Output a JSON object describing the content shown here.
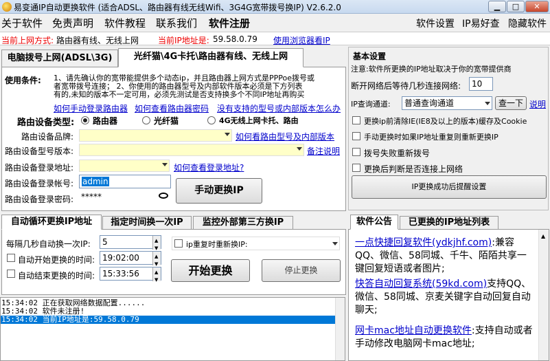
{
  "window": {
    "title": "易变通IP自动更换软件 (适合ADSL、路由器有线无线Wifi、3G4G宽带拨号换IP) V2.6.2.0",
    "btn_min": "▁",
    "btn_max": "□",
    "btn_close": "✕"
  },
  "menu": {
    "items": [
      "关于软件",
      "免责声明",
      "软件教程",
      "联系我们",
      "软件注册"
    ],
    "right": [
      "软件设置",
      "IP易好查",
      "隐藏软件"
    ]
  },
  "status": {
    "mode_label": "当前上网方式:",
    "mode_value": "路由器有线、无线上网",
    "ip_label": "当前IP地址是:",
    "ip_value": "59.58.0.79",
    "browser_link": "使用浏览器看IP"
  },
  "tabs": {
    "adsl": "电脑拨号上网(ADSL\\3G)",
    "router": "光纤猫\\4G卡托\\路由器有线、无线上网"
  },
  "router_panel": {
    "condition_label": "使用条件:",
    "condition_lines": [
      "1、请先确认你的宽带能提供多个动态ip，并且路由器上网方式是PPPoe拨号或",
      "者宽带拨号连接；  2、你使用的路由器型号及内部软件版本必须是下方列表",
      "有的,未知的版本不一定可用，必须先测试是否支持换多个不同IP地址再购买"
    ],
    "links": [
      "如何手动登录路由器",
      "如何查看路由器密码",
      "没有支持的型号或内部版本怎么办"
    ],
    "device_type_label": "路由设备类型:",
    "device_types": [
      "路由器",
      "光纤猫",
      "4G无线上网卡托、路由"
    ],
    "brand_label": "路由设备品牌:",
    "brand_link": "如何看路由型号及内部版本",
    "model_label": "路由设备型号版本:",
    "model_link": "备注说明",
    "address_label": "路由设备登录地址:",
    "address_link": "如何查看登录地址?",
    "account_label": "路由设备登录帐号:",
    "account_value": "admin",
    "password_label": "路由设备登录密码:",
    "password_value": "*****",
    "manual_button": "手动更换IP"
  },
  "basic_settings": {
    "title": "基本设置",
    "note": "注意:软件所更换的IP地址取决于你的宽带提供商",
    "reconnect_label": "断开网络后等待几秒连接网络:",
    "reconnect_value": "10",
    "query_label": "IP查询通道:",
    "query_value": "普通查询通道",
    "check_button": "查一下",
    "explain_link": "说明",
    "checkboxes": [
      "更换ip前清除IE(IE8及以上的版本)缓存及Cookie",
      "手动更换时如果IP地址重复则重新更换IP",
      "拨号失败重新拨号",
      "更换后判断是否连接上网络"
    ],
    "remind_button": "IP更换成功后提醒设置"
  },
  "auto_tabs": {
    "labels": [
      "自动循环更换IP地址",
      "指定时间换一次IP",
      "监控外部第三方换IP"
    ],
    "interval_label": "每隔几秒自动换一次IP:",
    "interval_value": "5",
    "start_label": "自动开始更换的时间:",
    "start_value": "19:02:00",
    "end_label": "自动结束更换的时间:",
    "end_value": "15:33:56",
    "repeat_label": "ip重复时重新换IP:",
    "start_button": "开始更换",
    "stop_button": "停止更换"
  },
  "log": [
    "15:34:02 正在获取网络数据配置......",
    "15:34:02 软件未注册!",
    "15:34:02 当前IP地址是:59.58.0.79"
  ],
  "right_tabs": {
    "notice": "软件公告",
    "history": "已更换的IP地址列表"
  },
  "announcement": [
    {
      "link": "一点快捷回复软件(ydkjhf.com)",
      "text": ":兼容QQ、微信、58同城、千牛、陌陌共享一键回复短语或者图片;"
    },
    {
      "link": "快答自动回复系统(59kd.com)",
      "text": "支持QQ、微信、58同城、京麦关键字自动回复自动聊天;"
    },
    {
      "link": "网卡mac地址自动更换软件",
      "text": ":支持自动或者手动修改电脑网卡mac地址;"
    }
  ],
  "colors": {
    "accent_link": "#0000cc",
    "warn": "#ee0000",
    "field_yellow": "#ffffc8",
    "selection": "#0078d7"
  }
}
